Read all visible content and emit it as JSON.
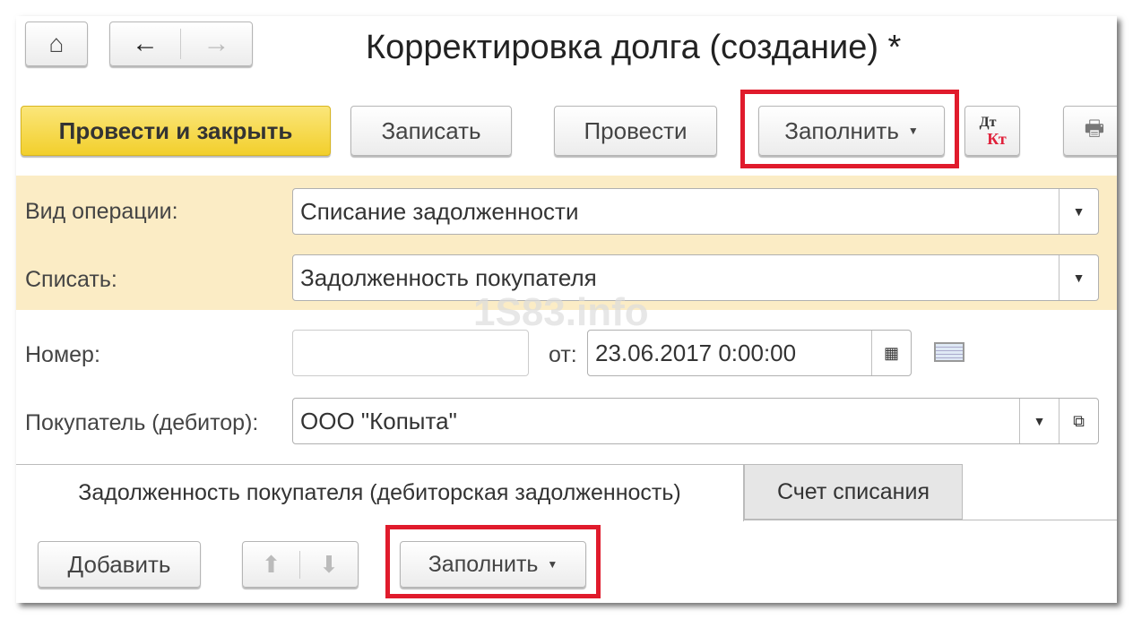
{
  "nav": {
    "home_icon": "home-icon",
    "back_icon": "arrow-left-icon",
    "forward_icon": "arrow-right-icon"
  },
  "header": {
    "title": "Корректировка долга (создание) *"
  },
  "toolbar": {
    "post_close": "Провести и закрыть",
    "save": "Записать",
    "post": "Провести",
    "fill": "Заполнить",
    "dtkt_top": "Дт",
    "dtkt_bottom": "Кт"
  },
  "form": {
    "operation_label": "Вид операции:",
    "operation_value": "Списание задолженности",
    "writeoff_label": "Списать:",
    "writeoff_value": "Задолженность покупателя",
    "number_label": "Номер:",
    "number_value": "",
    "date_label": "от:",
    "date_value": "23.06.2017  0:00:00",
    "buyer_label": "Покупатель (дебитор):",
    "buyer_value": "ООО \"Копыта\""
  },
  "tabs": [
    {
      "label": "Задолженность покупателя (дебиторская задолженность)",
      "active": true
    },
    {
      "label": "Счет списания",
      "active": false
    }
  ],
  "table_toolbar": {
    "add": "Добавить",
    "fill": "Заполнить"
  },
  "watermark": "1S83.info",
  "colors": {
    "highlight": "#e01b2c",
    "primary": "#f2cf2c",
    "band": "#fbecc5"
  }
}
